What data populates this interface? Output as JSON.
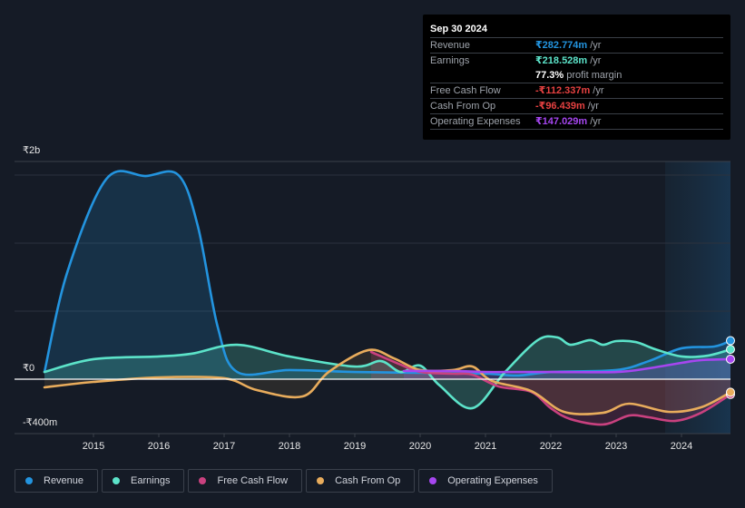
{
  "tooltip": {
    "date": "Sep 30 2024",
    "rows": [
      {
        "label": "Revenue",
        "value": "₹282.774m",
        "unit": "/yr",
        "color": "#2394df"
      },
      {
        "label": "Earnings",
        "value": "₹218.528m",
        "unit": "/yr",
        "color": "#5ce3c9"
      },
      {
        "label": "",
        "value": "77.3%",
        "unit": "profit margin",
        "color": "#ffffff"
      },
      {
        "label": "Free Cash Flow",
        "value": "-₹112.337m",
        "unit": "/yr",
        "color": "#e64141"
      },
      {
        "label": "Cash From Op",
        "value": "-₹96.439m",
        "unit": "/yr",
        "color": "#e64141"
      },
      {
        "label": "Operating Expenses",
        "value": "₹147.029m",
        "unit": "/yr",
        "color": "#a646f0"
      }
    ]
  },
  "legend": [
    {
      "label": "Revenue",
      "color": "#2394df"
    },
    {
      "label": "Earnings",
      "color": "#5ce3c9"
    },
    {
      "label": "Free Cash Flow",
      "color": "#c9417f"
    },
    {
      "label": "Cash From Op",
      "color": "#e8ac5c"
    },
    {
      "label": "Operating Expenses",
      "color": "#a646f0"
    }
  ],
  "chart_data": {
    "type": "area",
    "title": "",
    "xlabel": "",
    "ylabel": "",
    "y_tick_labels": [
      "₹2b",
      "₹0",
      "-₹400m"
    ],
    "x_tick_labels": [
      "2015",
      "2016",
      "2017",
      "2018",
      "2019",
      "2020",
      "2021",
      "2022",
      "2023",
      "2024"
    ],
    "x_range": [
      2014.25,
      2024.75
    ],
    "y_range_m": [
      -400,
      1600
    ],
    "forecast_shaded_from": 2023.75,
    "grid": true,
    "legend_position": "bottom",
    "units": "INR millions",
    "series": [
      {
        "name": "Revenue",
        "color": "#2394df",
        "points": [
          [
            2014.25,
            53
          ],
          [
            2014.6,
            787
          ],
          [
            2015.2,
            1473
          ],
          [
            2015.8,
            1493
          ],
          [
            2016.3,
            1500
          ],
          [
            2016.6,
            1120
          ],
          [
            2016.9,
            387
          ],
          [
            2017.2,
            53
          ],
          [
            2018,
            67
          ],
          [
            2019,
            53
          ],
          [
            2020,
            47
          ],
          [
            2021,
            40
          ],
          [
            2021.5,
            27
          ],
          [
            2022,
            53
          ],
          [
            2023,
            67
          ],
          [
            2023.5,
            133
          ],
          [
            2024,
            227
          ],
          [
            2024.5,
            240
          ],
          [
            2024.75,
            283
          ]
        ]
      },
      {
        "name": "Earnings",
        "color": "#5ce3c9",
        "points": [
          [
            2014.25,
            53
          ],
          [
            2015,
            147
          ],
          [
            2016,
            167
          ],
          [
            2016.5,
            187
          ],
          [
            2017.2,
            253
          ],
          [
            2018,
            167
          ],
          [
            2019,
            93
          ],
          [
            2019.4,
            133
          ],
          [
            2019.7,
            53
          ],
          [
            2020,
            100
          ],
          [
            2020.3,
            -47
          ],
          [
            2020.8,
            -213
          ],
          [
            2021.3,
            53
          ],
          [
            2021.8,
            287
          ],
          [
            2022.1,
            307
          ],
          [
            2022.3,
            253
          ],
          [
            2022.6,
            287
          ],
          [
            2022.8,
            253
          ],
          [
            2023,
            280
          ],
          [
            2023.3,
            273
          ],
          [
            2023.6,
            220
          ],
          [
            2024,
            167
          ],
          [
            2024.4,
            173
          ],
          [
            2024.75,
            219
          ]
        ]
      },
      {
        "name": "Free Cash Flow",
        "color": "#c9417f",
        "points": [
          [
            2019.25,
            200
          ],
          [
            2019.7,
            107
          ],
          [
            2020,
            53
          ],
          [
            2020.5,
            40
          ],
          [
            2020.8,
            33
          ],
          [
            2021.2,
            -53
          ],
          [
            2021.7,
            -93
          ],
          [
            2022,
            -213
          ],
          [
            2022.3,
            -293
          ],
          [
            2022.8,
            -333
          ],
          [
            2023.2,
            -267
          ],
          [
            2023.5,
            -280
          ],
          [
            2023.9,
            -307
          ],
          [
            2024.3,
            -247
          ],
          [
            2024.75,
            -112
          ]
        ]
      },
      {
        "name": "Cash From Op",
        "color": "#e8ac5c",
        "points": [
          [
            2014.25,
            -60
          ],
          [
            2015,
            -20
          ],
          [
            2016,
            13
          ],
          [
            2017,
            7
          ],
          [
            2017.5,
            -80
          ],
          [
            2018.2,
            -127
          ],
          [
            2018.6,
            53
          ],
          [
            2019.2,
            213
          ],
          [
            2019.6,
            153
          ],
          [
            2020,
            67
          ],
          [
            2020.5,
            67
          ],
          [
            2020.8,
            93
          ],
          [
            2021.1,
            -13
          ],
          [
            2021.7,
            -87
          ],
          [
            2022.2,
            -240
          ],
          [
            2022.8,
            -247
          ],
          [
            2023.2,
            -180
          ],
          [
            2023.8,
            -240
          ],
          [
            2024.3,
            -207
          ],
          [
            2024.75,
            -96
          ]
        ]
      },
      {
        "name": "Operating Expenses",
        "color": "#a646f0",
        "points": [
          [
            2019.75,
            60
          ],
          [
            2020.5,
            60
          ],
          [
            2021,
            53
          ],
          [
            2021.5,
            53
          ],
          [
            2022,
            53
          ],
          [
            2023,
            53
          ],
          [
            2023.5,
            80
          ],
          [
            2024,
            120
          ],
          [
            2024.3,
            140
          ],
          [
            2024.75,
            147
          ]
        ]
      }
    ]
  }
}
